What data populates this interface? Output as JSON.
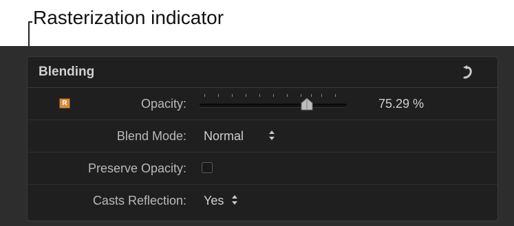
{
  "annotation": {
    "label": "Rasterization indicator"
  },
  "panel": {
    "title": "Blending",
    "reset_icon": "reset-arrow-icon"
  },
  "rows": {
    "opacity": {
      "label": "Opacity:",
      "indicator_letter": "R",
      "value_text": "75.29  %",
      "value": 75.29
    },
    "blend_mode": {
      "label": "Blend Mode:",
      "value": "Normal"
    },
    "preserve_opacity": {
      "label": "Preserve Opacity:",
      "checked": false
    },
    "casts_reflection": {
      "label": "Casts Reflection:",
      "value": "Yes"
    }
  },
  "colors": {
    "panel_background": "#2d2d2d",
    "inspector_background": "#1f1f1f",
    "indicator_orange": "#d98a3c"
  }
}
